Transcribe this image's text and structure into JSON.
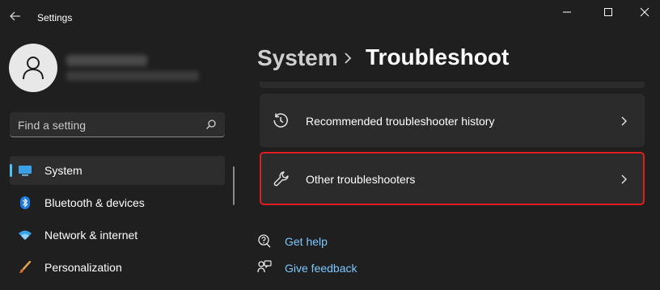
{
  "window": {
    "title": "Settings"
  },
  "search": {
    "placeholder": "Find a setting"
  },
  "sidebar": {
    "items": [
      {
        "label": "System"
      },
      {
        "label": "Bluetooth & devices"
      },
      {
        "label": "Network & internet"
      },
      {
        "label": "Personalization"
      }
    ]
  },
  "breadcrumb": {
    "parent": "System",
    "current": "Troubleshoot"
  },
  "cards": [
    {
      "label": "Recommended troubleshooter history",
      "icon": "history-icon"
    },
    {
      "label": "Other troubleshooters",
      "icon": "wrench-icon"
    }
  ],
  "links": {
    "help": "Get help",
    "feedback": "Give feedback"
  },
  "colors": {
    "accent": "#4cc2ff",
    "highlight": "#e01e1e",
    "background": "#1f1f1f",
    "card": "#2b2b2b"
  }
}
